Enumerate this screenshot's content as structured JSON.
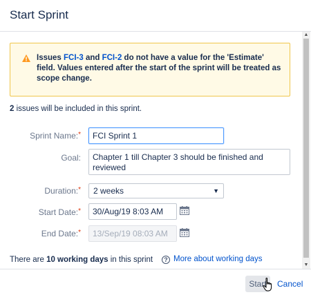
{
  "dialog": {
    "title": "Start Sprint"
  },
  "warning": {
    "prefix": "Issues ",
    "issue1": "FCI-3",
    "and": " and ",
    "issue2": "FCI-2",
    "suffix": " do not have a value for the 'Estimate' field. Values entered after the start of the sprint will be treated as scope change.",
    "icon": "warning-icon",
    "color": "#f0c64a"
  },
  "issues": {
    "count": "2",
    "text": " issues will be included in this sprint."
  },
  "form": {
    "sprint_name": {
      "label": "Sprint Name:",
      "value": "FCI Sprint 1",
      "required": "*"
    },
    "goal": {
      "label": "Goal:",
      "value": "Chapter 1 till Chapter 3 should be finished and reviewed"
    },
    "duration": {
      "label": "Duration:",
      "value": "2 weeks",
      "required": "*"
    },
    "start_date": {
      "label": "Start Date:",
      "value": "30/Aug/19 8:03 AM",
      "required": "*"
    },
    "end_date": {
      "label": "End Date:",
      "value": "13/Sep/19 08:03 AM",
      "required": "*"
    }
  },
  "working_days": {
    "prefix": "There are ",
    "count": "10 working days",
    "suffix": " in this sprint",
    "help_link": "More about working days"
  },
  "footer": {
    "start_label": "Start",
    "cancel_label": "Cancel"
  },
  "colors": {
    "link": "#0052cc",
    "required": "#de350b"
  }
}
